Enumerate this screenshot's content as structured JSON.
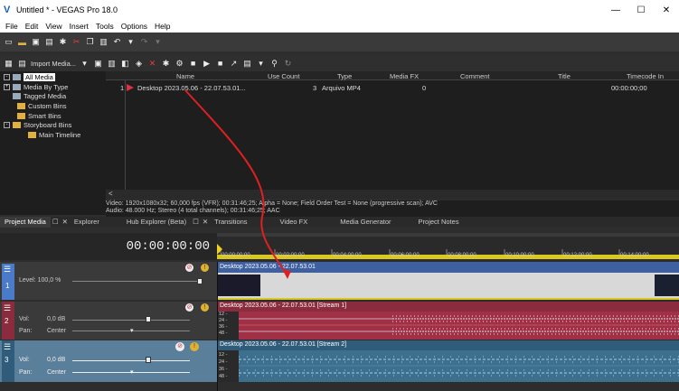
{
  "window": {
    "title": "Untitled * - VEGAS Pro 18.0"
  },
  "menu": [
    "File",
    "Edit",
    "View",
    "Insert",
    "Tools",
    "Options",
    "Help"
  ],
  "media_toolbar": {
    "import_label": "Import Media..."
  },
  "tree": {
    "items": [
      {
        "label": "All Media",
        "selected": true
      },
      {
        "label": "Media By Type"
      },
      {
        "label": "Tagged Media"
      },
      {
        "label": "Custom Bins"
      },
      {
        "label": "Smart Bins"
      },
      {
        "label": "Storyboard Bins"
      },
      {
        "label": "Main Timeline"
      }
    ]
  },
  "grid": {
    "columns": [
      "Name",
      "Use Count",
      "Type",
      "Media FX",
      "Comment",
      "Title",
      "Timecode In"
    ],
    "row": {
      "index": "1",
      "name": "Desktop 2023.05.06 - 22.07.53.01...",
      "use_count": "3",
      "type": "Arquivo MP4",
      "media_fx": "0",
      "timecode_in": "00:00:00;00"
    }
  },
  "info": {
    "video": "Video: 1920x1080x32; 60,000 fps (VFR); 00:31:46;25; Alpha = None; Field Order Test = None (progressive scan); AVC",
    "audio": "Audio: 48.000 Hz; Stereo (4 total channels); 00:31:46;25; AAC"
  },
  "tabs": {
    "project_media": "Project Media",
    "explorer": "Explorer",
    "hub_explorer": "Hub Explorer (Beta)",
    "transitions": "Transitions",
    "video_fx": "Video FX",
    "media_generator": "Media Generator",
    "project_notes": "Project Notes"
  },
  "timeline": {
    "timecode": "00:00:00:00",
    "ruler_marks": [
      "00:00:00:00",
      "00:02:00:00",
      "00:04:00:00",
      "00:06:00:00",
      "00:08:00:00",
      "00:10:00:00",
      "00:12:00:00",
      "00:14:00:00"
    ]
  },
  "tracks": [
    {
      "kind": "video",
      "number": "1",
      "level_label": "Level: 100,0 %",
      "clip_title": "Desktop 2023.05.06 - 22.07.53.01"
    },
    {
      "kind": "audio",
      "number": "2",
      "vol_label": "Vol:",
      "vol_value": "0,0 dB",
      "pan_label": "Pan:",
      "pan_value": "Center",
      "clip_title": "Desktop 2023.05.06 - 22.07.53.01 [Stream 1]",
      "scale": [
        "12 -",
        "24 -",
        "36 -",
        "48 -"
      ]
    },
    {
      "kind": "audio",
      "number": "3",
      "vol_label": "Vol:",
      "vol_value": "0,0 dB",
      "pan_label": "Pan:",
      "pan_value": "Center",
      "clip_title": "Desktop 2023.05.06 - 22.07.53.01 [Stream 2]",
      "scale": [
        "12 -",
        "24 -",
        "36 -",
        "48 -"
      ]
    }
  ],
  "colors": {
    "video_clip_header": "#3e5fa0",
    "audio1_clip_header": "#8a2c3e",
    "audio1_wave_bg": "#a03045",
    "audio2_clip_header": "#2f5c7a",
    "audio2_wave_bg": "#3d6f8f",
    "annotation_arrow": "#e02020"
  }
}
